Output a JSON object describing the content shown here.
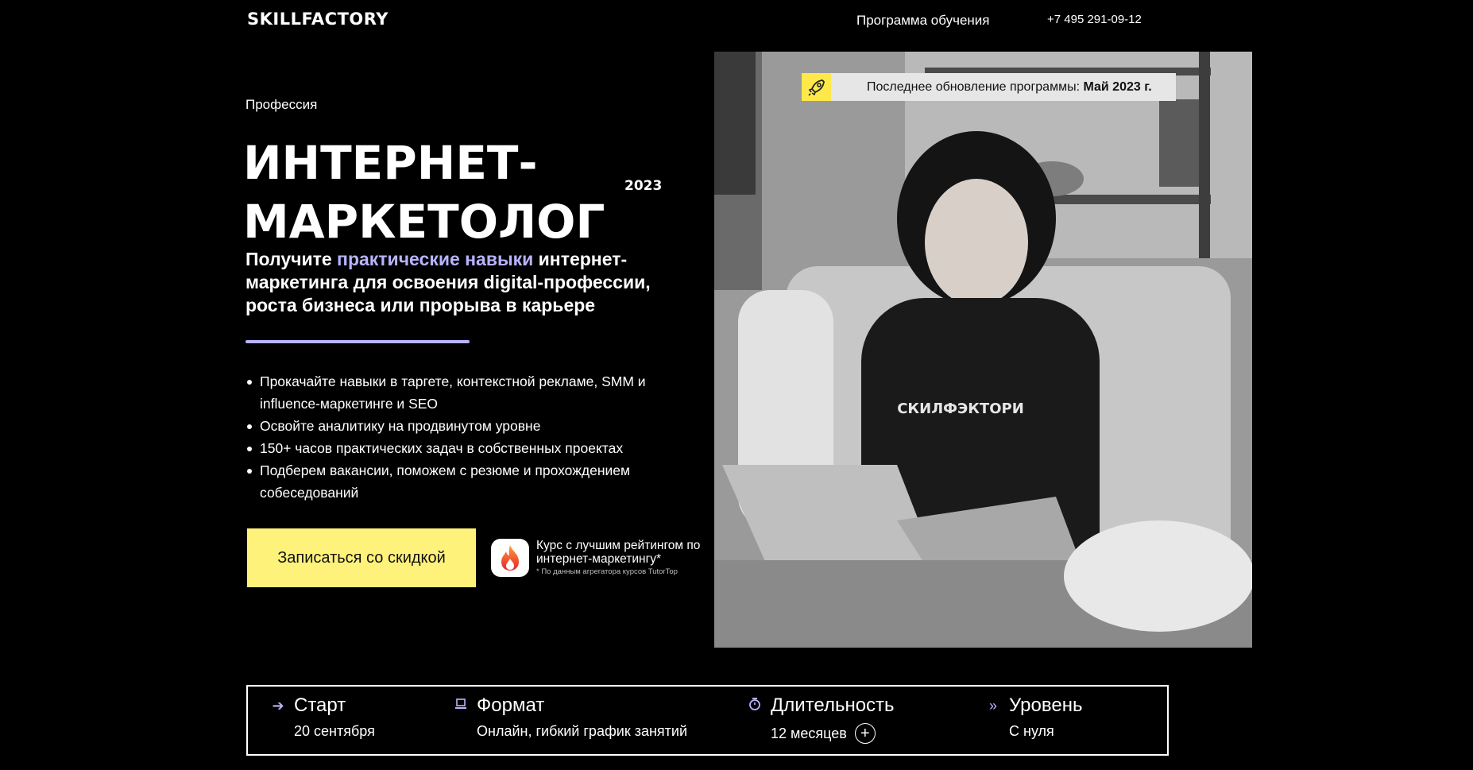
{
  "header": {
    "logo": "SKILLFACTORY",
    "nav_program": "Программа обучения",
    "phone": "+7 495 291-09-12"
  },
  "hero": {
    "eyebrow": "Профессия",
    "title_line1": "ИНТЕРНЕТ-",
    "title_line2": "МАРКЕТОЛОГ",
    "year": "2023",
    "subtitle_pre": "Получите ",
    "subtitle_accent": "практические навыки",
    "subtitle_post": " интернет-маркетинга для освоения digital-профессии, роста бизнеса или прорыва в карьере",
    "bullets": [
      "Прокачайте навыки в таргете, контекстной рекламе, SMM и influence-маркетинге и SEO",
      "Освойте аналитику на продвинутом уровне",
      "150+ часов практических задач в собственных проектах",
      "Подберем вакансии, поможем с резюме и прохождением собеседований"
    ],
    "cta_label": "Записаться со скидкой",
    "badge_title": "Курс с лучшим рейтингом по интернет-маркетингу*",
    "badge_note": "* По данным агрегатора курсов TutorTop"
  },
  "photo": {
    "update_label": "Последнее обновление программы: ",
    "update_value": "Май 2023 г."
  },
  "info": {
    "start_label": "Старт",
    "start_value": "20 сентября",
    "format_label": "Формат",
    "format_value": "Онлайн, гибкий график занятий",
    "duration_label": "Длительность",
    "duration_value": "12 месяцев",
    "duration_more": "+",
    "level_label": "Уровень",
    "level_value": "С нуля"
  },
  "colors": {
    "accent_lavender": "#b8b4ff",
    "cta_yellow": "#fff27a",
    "background": "#000000"
  },
  "icons": {
    "start": "arrow-right-icon",
    "format": "laptop-icon",
    "duration": "stopwatch-icon",
    "level": "double-chevron-icon",
    "update": "rocket-icon",
    "badge": "flame-icon"
  }
}
